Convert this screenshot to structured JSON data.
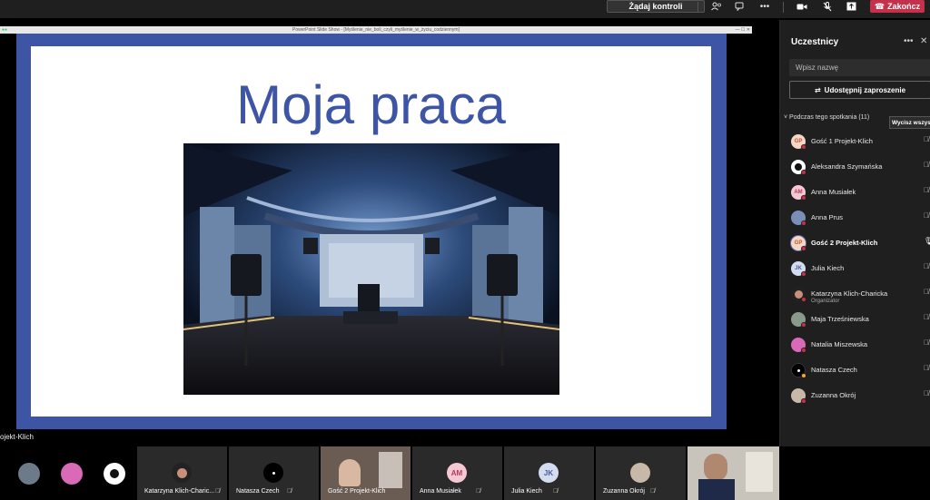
{
  "topbar": {
    "request_control_label": "Żądaj kontroli",
    "end_label": "Zakończ",
    "icons": [
      "participants-icon",
      "chat-icon",
      "more-icon",
      "camera-icon",
      "mic-off-icon",
      "share-icon",
      "phone-icon"
    ]
  },
  "share": {
    "window_title": "PowerPoint Slide Show - [Myślenie_nie_boli_czyli_myślenie_w_życiu_codziennym]",
    "presenter_label": "ojekt-Klich",
    "slide_title": "Moja praca",
    "colors": {
      "frame": "#3d55a4",
      "title": "#3d55a4"
    }
  },
  "panel": {
    "title": "Uczestnicy",
    "search_placeholder": "Wpisz nazwę",
    "invite_label": "Udostępnij zaproszenie",
    "meeting_header": "Podczas tego spotkania (11)",
    "mute_all_label": "Wycisz wszystk...",
    "participants": [
      {
        "name": "Gość 1 Projekt-Klich",
        "initials": "GP",
        "role": "",
        "bold": false,
        "mic": "mic-off"
      },
      {
        "name": "Aleksandra Szymańska",
        "initials": "",
        "role": "",
        "bold": false,
        "mic": "mic-off"
      },
      {
        "name": "Anna Musiałek",
        "initials": "AM",
        "role": "",
        "bold": false,
        "mic": "mic-off"
      },
      {
        "name": "Anna Prus",
        "initials": "",
        "role": "",
        "bold": false,
        "mic": "mic-off"
      },
      {
        "name": "Gość 2 Projekt-Klich",
        "initials": "GP",
        "role": "",
        "bold": true,
        "mic": "mic-on"
      },
      {
        "name": "Julia Kiech",
        "initials": "JK",
        "role": "",
        "bold": false,
        "mic": "mic-off"
      },
      {
        "name": "Katarzyna Klich-Charicka",
        "initials": "",
        "role": "Organizator",
        "bold": false,
        "mic": "mic-off"
      },
      {
        "name": "Maja Trześniewska",
        "initials": "",
        "role": "",
        "bold": false,
        "mic": "mic-off"
      },
      {
        "name": "Natalia Miszewska",
        "initials": "",
        "role": "",
        "bold": false,
        "mic": "mic-off"
      },
      {
        "name": "Natasza Czech",
        "initials": "",
        "role": "",
        "bold": false,
        "mic": "mic-off"
      },
      {
        "name": "Zuzanna Okrój",
        "initials": "",
        "role": "",
        "bold": false,
        "mic": "mic-off"
      }
    ]
  },
  "strip": {
    "tiles": [
      {
        "name": "Katarzyna Klich-Charic...",
        "initials": ""
      },
      {
        "name": "Natasza Czech",
        "initials": ""
      },
      {
        "name": "Gość 2 Projekt-Klich",
        "initials": ""
      },
      {
        "name": "Anna Musiałek",
        "initials": "AM"
      },
      {
        "name": "Julia Kiech",
        "initials": "JK"
      },
      {
        "name": "Zuzanna Okrój",
        "initials": ""
      }
    ]
  }
}
